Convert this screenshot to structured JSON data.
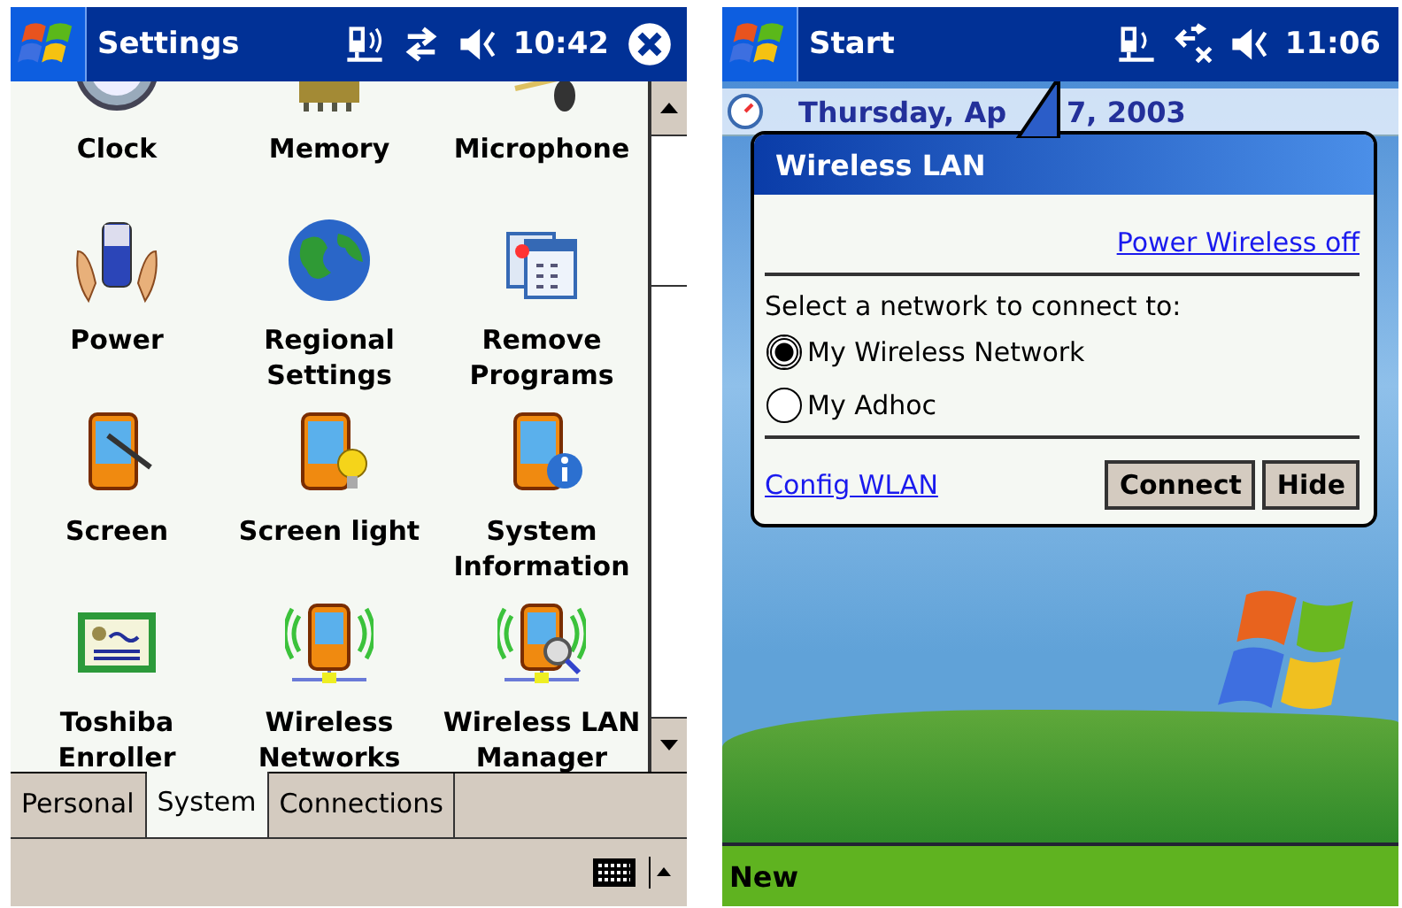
{
  "left_screen": {
    "title_bar": {
      "title": "Settings",
      "time": "10:42"
    },
    "settings_items": [
      {
        "label": "Clock"
      },
      {
        "label": "Memory"
      },
      {
        "label": "Microphone"
      },
      {
        "label": "Power"
      },
      {
        "label": "Regional Settings"
      },
      {
        "label": "Remove Programs"
      },
      {
        "label": "Screen"
      },
      {
        "label": "Screen light"
      },
      {
        "label": "System Information"
      },
      {
        "label": "Toshiba Enroller"
      },
      {
        "label": "Wireless Networks"
      },
      {
        "label": "Wireless LAN Manager"
      }
    ],
    "tabs": [
      {
        "label": "Personal",
        "selected": false
      },
      {
        "label": "System",
        "selected": true
      },
      {
        "label": "Connections",
        "selected": false
      }
    ]
  },
  "right_screen": {
    "title_bar": {
      "title": "Start",
      "time": "11:06"
    },
    "today_date": [
      "Thursday, Ap",
      "7, 2003"
    ],
    "popup": {
      "title": "Wireless LAN",
      "power_link": "Power Wireless off",
      "prompt": "Select a network to connect to:",
      "networks": [
        {
          "label": "My Wireless Network",
          "selected": true
        },
        {
          "label": "My Adhoc",
          "selected": false
        }
      ],
      "config_link": "Config WLAN",
      "buttons": [
        "Connect",
        "Hide"
      ]
    },
    "menu_bar": {
      "left_softkey": "New"
    }
  }
}
